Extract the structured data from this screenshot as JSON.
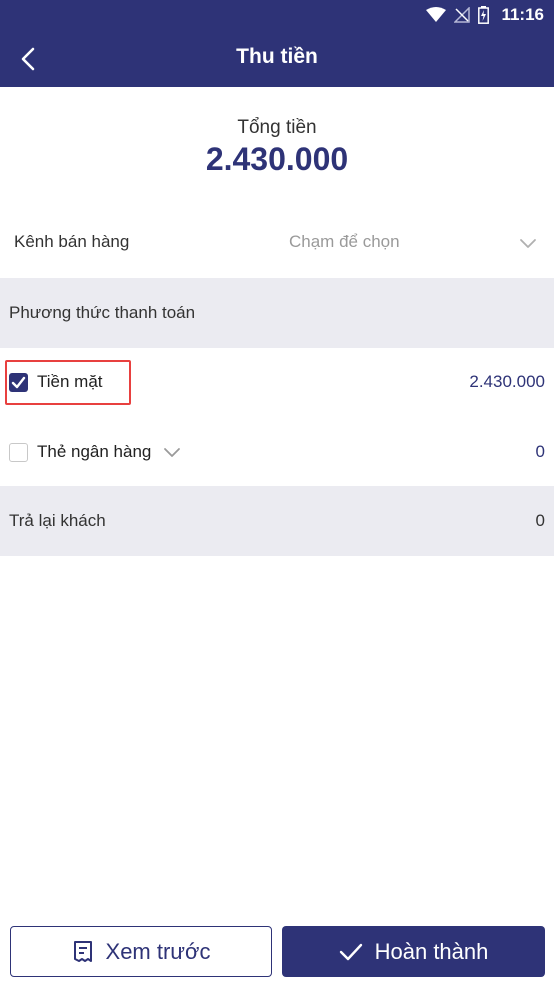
{
  "status_bar": {
    "time": "11:16"
  },
  "header": {
    "title": "Thu tiền"
  },
  "summary": {
    "total_label": "Tổng tiền",
    "total_value": "2.430.000"
  },
  "sales_channel": {
    "label": "Kênh bán hàng",
    "placeholder": "Chạm để chọn"
  },
  "payment": {
    "section_title": "Phương thức thanh toán",
    "methods": [
      {
        "label": "Tiền mặt",
        "amount": "2.430.000",
        "checked": true
      },
      {
        "label": "Thẻ ngân hàng",
        "amount": "0",
        "checked": false
      }
    ]
  },
  "refund": {
    "label": "Trả lại khách",
    "value": "0"
  },
  "actions": {
    "preview_label": "Xem trước",
    "complete_label": "Hoàn thành"
  },
  "colors": {
    "primary": "#2e3377",
    "section_bg": "#ebebf1",
    "highlight": "#e8403f"
  },
  "icons": [
    "wifi-icon",
    "no-signal-icon",
    "battery-icon",
    "back-arrow-icon",
    "chevron-down-icon",
    "checkmark-icon",
    "receipt-icon"
  ]
}
